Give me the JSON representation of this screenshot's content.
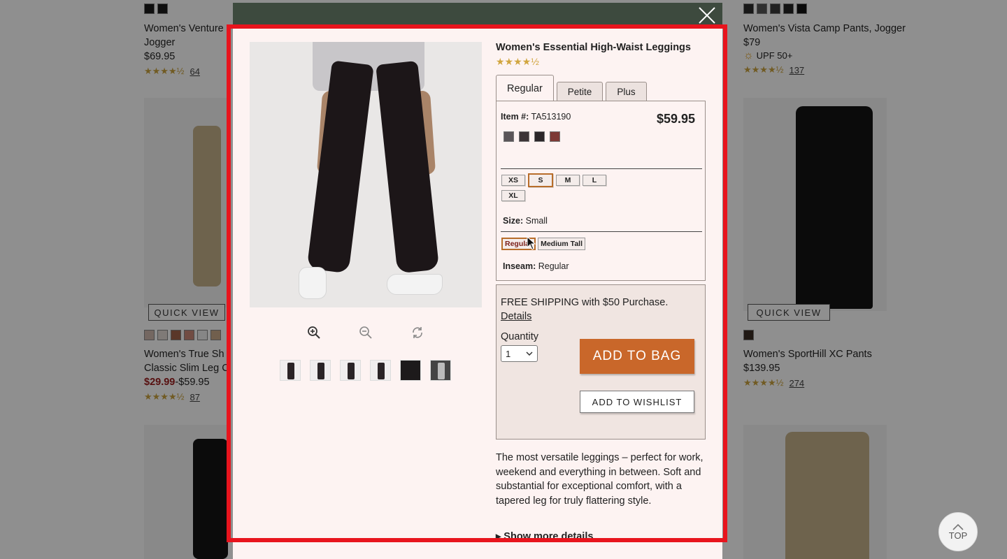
{
  "background": {
    "left_column": [
      {
        "name_line1": "Women's Venture",
        "name_line2": "Jogger",
        "price": "$69.95",
        "stars": "★★★★½",
        "reviews": "64"
      },
      {
        "quick_view": "QUICK VIEW",
        "name_line1": "Women's True Sh",
        "name_line2": "Classic Slim Leg C",
        "sale_price": "$29.99",
        "price_rest": "-$59.95",
        "stars": "★★★★½",
        "reviews": "87"
      }
    ],
    "right_column": [
      {
        "name": "Women's Vista Camp Pants, Jogger",
        "price": "$79",
        "badge": "UPF 50+",
        "stars": "★★★★½",
        "reviews": "137"
      },
      {
        "quick_view": "QUICK VIEW",
        "name": "Women's SportHill XC Pants",
        "price": "$139.95",
        "stars": "★★★★½",
        "reviews": "274"
      }
    ],
    "top_button": "TOP",
    "colors": {
      "swatches_left_top": [
        "#1a1a1a",
        "#1a1a1a"
      ],
      "swatches_left_mid": [
        "#d0b8ad",
        "#e3d9d4",
        "#a0624a",
        "#c98778",
        "#efefef",
        "#c9a98a"
      ],
      "swatches_right_top": [
        "#2a2a2a",
        "#555555",
        "#3b3b3b",
        "#222222",
        "#111111"
      ],
      "swatches_right_mid": [
        "#3a2c24"
      ]
    }
  },
  "modal": {
    "close_icon": "close-icon",
    "product_title": "Women's Essential High-Waist Leggings",
    "stars": "★★★★½",
    "tabs": [
      "Regular",
      "Petite",
      "Plus"
    ],
    "active_tab": "Regular",
    "item_label": "Item #:",
    "item_number": "TA513190",
    "price": "$59.95",
    "colors": [
      "#5a5558",
      "#3b3437",
      "#2b2629",
      "#7d3a36"
    ],
    "sizes": [
      "XS",
      "S",
      "M",
      "L",
      "XL"
    ],
    "selected_size": "S",
    "size_label": "Size:",
    "size_value": "Small",
    "inseams": [
      "Regular",
      "Medium Tall"
    ],
    "selected_inseam": "Regular",
    "inseam_label": "Inseam:",
    "inseam_value": "Regular",
    "shipping_text": "FREE SHIPPING with $50 Purchase.",
    "shipping_details": "Details",
    "quantity_label": "Quantity",
    "quantity_value": "1",
    "add_to_bag": "ADD TO BAG",
    "add_to_wishlist": "ADD TO WISHLIST",
    "description": "The most versatile leggings – perfect for work, weekend and everything in between. Soft and substantial for exceptional comfort, with a tapered leg for truly flattering style.",
    "show_more": "▸ Show more details",
    "accent_color": "#c9672a",
    "highlight_color": "#e8141d"
  }
}
